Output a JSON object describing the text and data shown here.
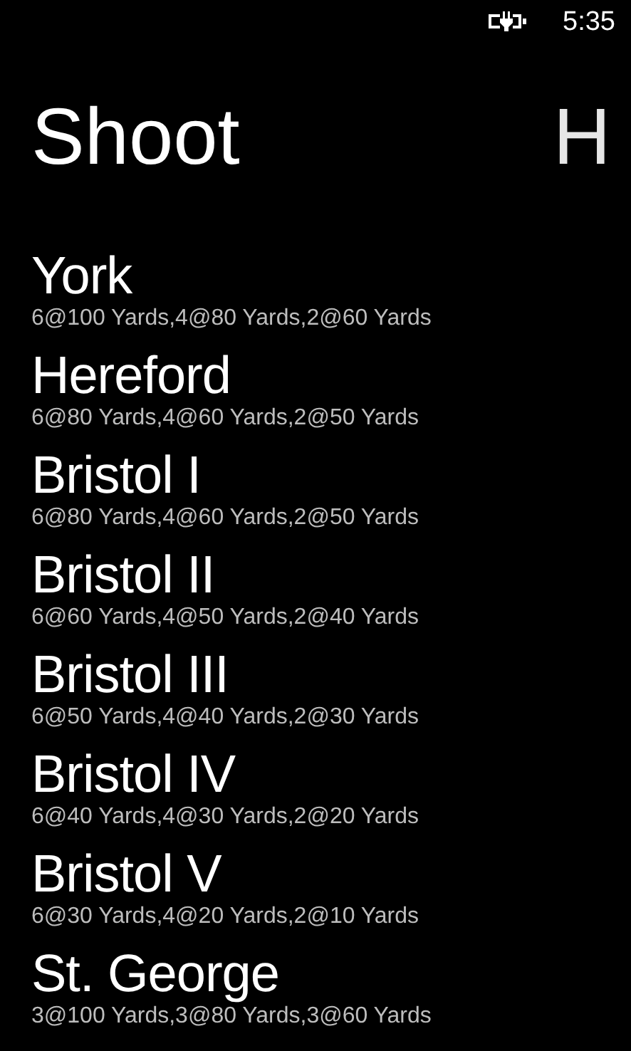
{
  "status_bar": {
    "time": "5:35"
  },
  "pivot": {
    "headers": [
      {
        "label": "Shoot",
        "selected": true
      },
      {
        "label": "H",
        "selected": false
      }
    ]
  },
  "rounds": [
    {
      "name": "York",
      "distances": "6@100 Yards,4@80 Yards,2@60 Yards"
    },
    {
      "name": "Hereford",
      "distances": "6@80 Yards,4@60 Yards,2@50 Yards"
    },
    {
      "name": "Bristol I",
      "distances": "6@80 Yards,4@60 Yards,2@50 Yards"
    },
    {
      "name": "Bristol II",
      "distances": "6@60 Yards,4@50 Yards,2@40 Yards"
    },
    {
      "name": "Bristol III",
      "distances": "6@50 Yards,4@40 Yards,2@30 Yards"
    },
    {
      "name": "Bristol IV",
      "distances": "6@40 Yards,4@30 Yards,2@20 Yards"
    },
    {
      "name": "Bristol V",
      "distances": "6@30 Yards,4@20 Yards,2@10 Yards"
    },
    {
      "name": "St. George",
      "distances": "3@100 Yards,3@80 Yards,3@60 Yards"
    }
  ]
}
